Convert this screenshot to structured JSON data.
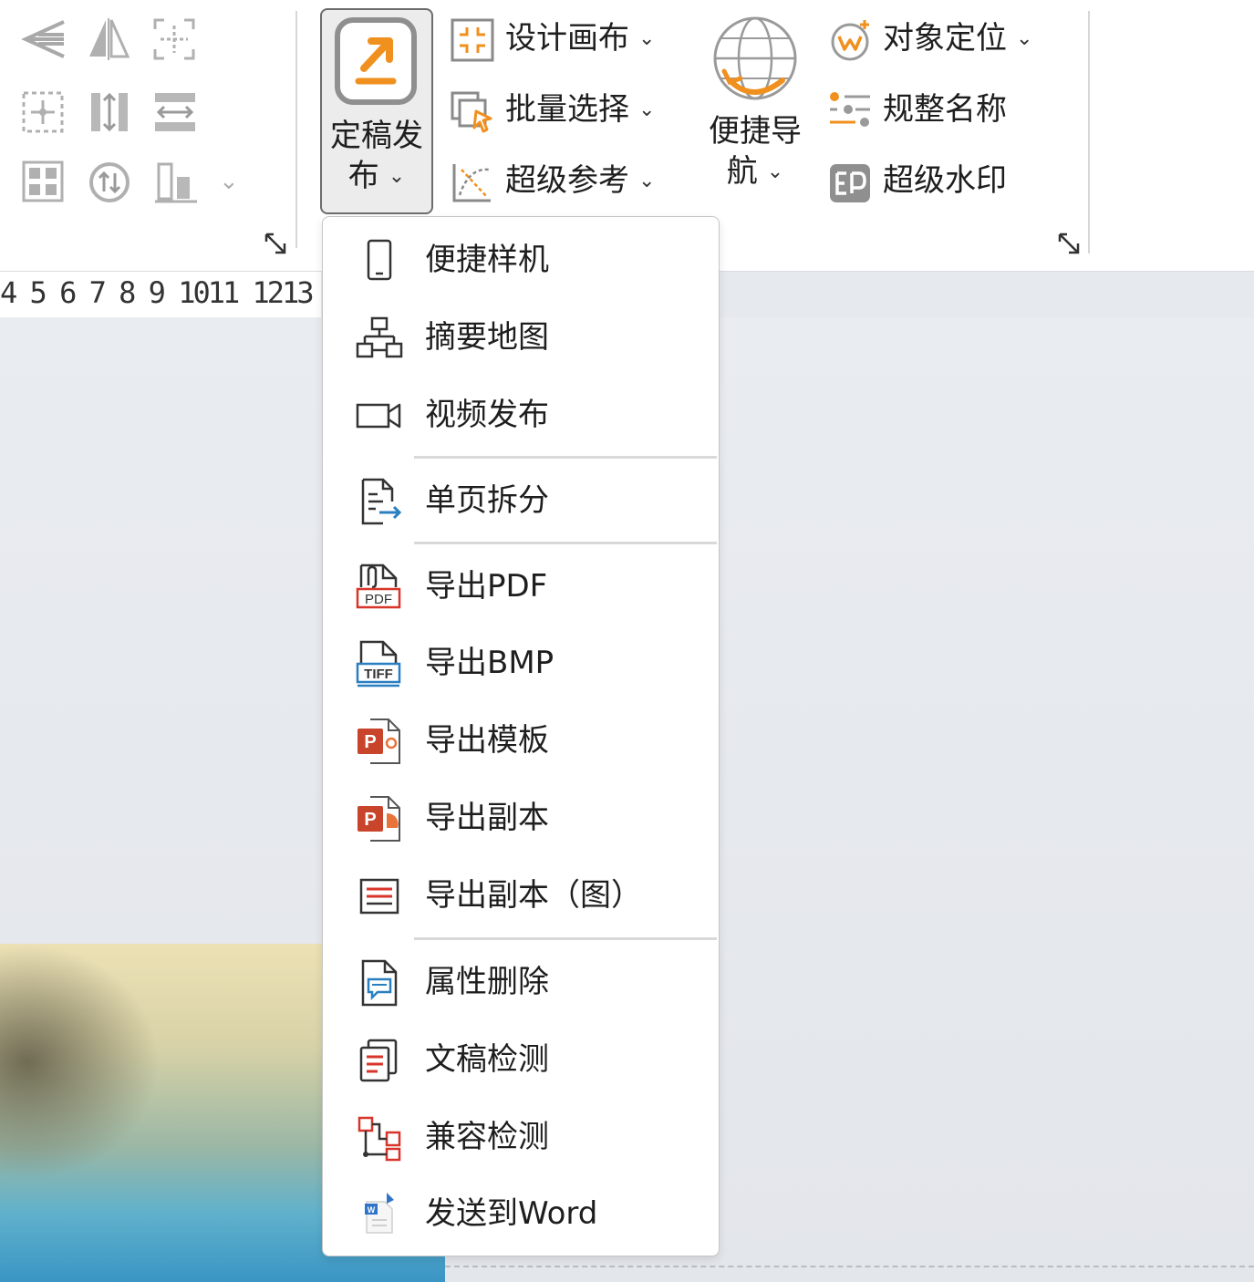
{
  "ribbon": {
    "publish": {
      "label_line1": "定稿发",
      "label_line2": "布",
      "chevron": "⌄"
    },
    "design_canvas": {
      "label": "设计画布",
      "chevron": "⌄"
    },
    "batch_select": {
      "label": "批量选择",
      "chevron": "⌄"
    },
    "super_reference": {
      "label": "超级参考",
      "chevron": "⌄"
    },
    "quick_nav": {
      "label_line1": "便捷导",
      "label_line2": "航",
      "chevron": "⌄"
    },
    "object_locate": {
      "label": "对象定位",
      "chevron": "⌄"
    },
    "normalize_names": {
      "label": "规整名称"
    },
    "super_watermark": {
      "label": "超级水印"
    },
    "small_chevron": "⌄"
  },
  "ruler": {
    "numbers": "4 5 6 7 8 9 1011 1213"
  },
  "menu": {
    "items": [
      {
        "label": "便捷样机",
        "icon": "phone-icon"
      },
      {
        "label": "摘要地图",
        "icon": "org-chart-icon"
      },
      {
        "label": "视频发布",
        "icon": "video-camera-icon"
      },
      {
        "label": "单页拆分",
        "icon": "page-split-icon"
      },
      {
        "label": "导出PDF",
        "icon": "pdf-file-icon"
      },
      {
        "label": "导出BMP",
        "icon": "tiff-file-icon"
      },
      {
        "label": "导出模板",
        "icon": "ppt-template-icon"
      },
      {
        "label": "导出副本",
        "icon": "ppt-copy-icon"
      },
      {
        "label": "导出副本（图）",
        "icon": "image-copy-icon"
      },
      {
        "label": "属性删除",
        "icon": "property-delete-icon"
      },
      {
        "label": "文稿检测",
        "icon": "document-check-icon"
      },
      {
        "label": "兼容检测",
        "icon": "compatibility-check-icon"
      },
      {
        "label": "发送到Word",
        "icon": "word-send-icon"
      }
    ]
  },
  "colors": {
    "accent_orange": "#f0901e",
    "pdf_red": "#d8352a",
    "tiff_blue": "#2a7fc1",
    "ppt_red": "#c8442a"
  }
}
